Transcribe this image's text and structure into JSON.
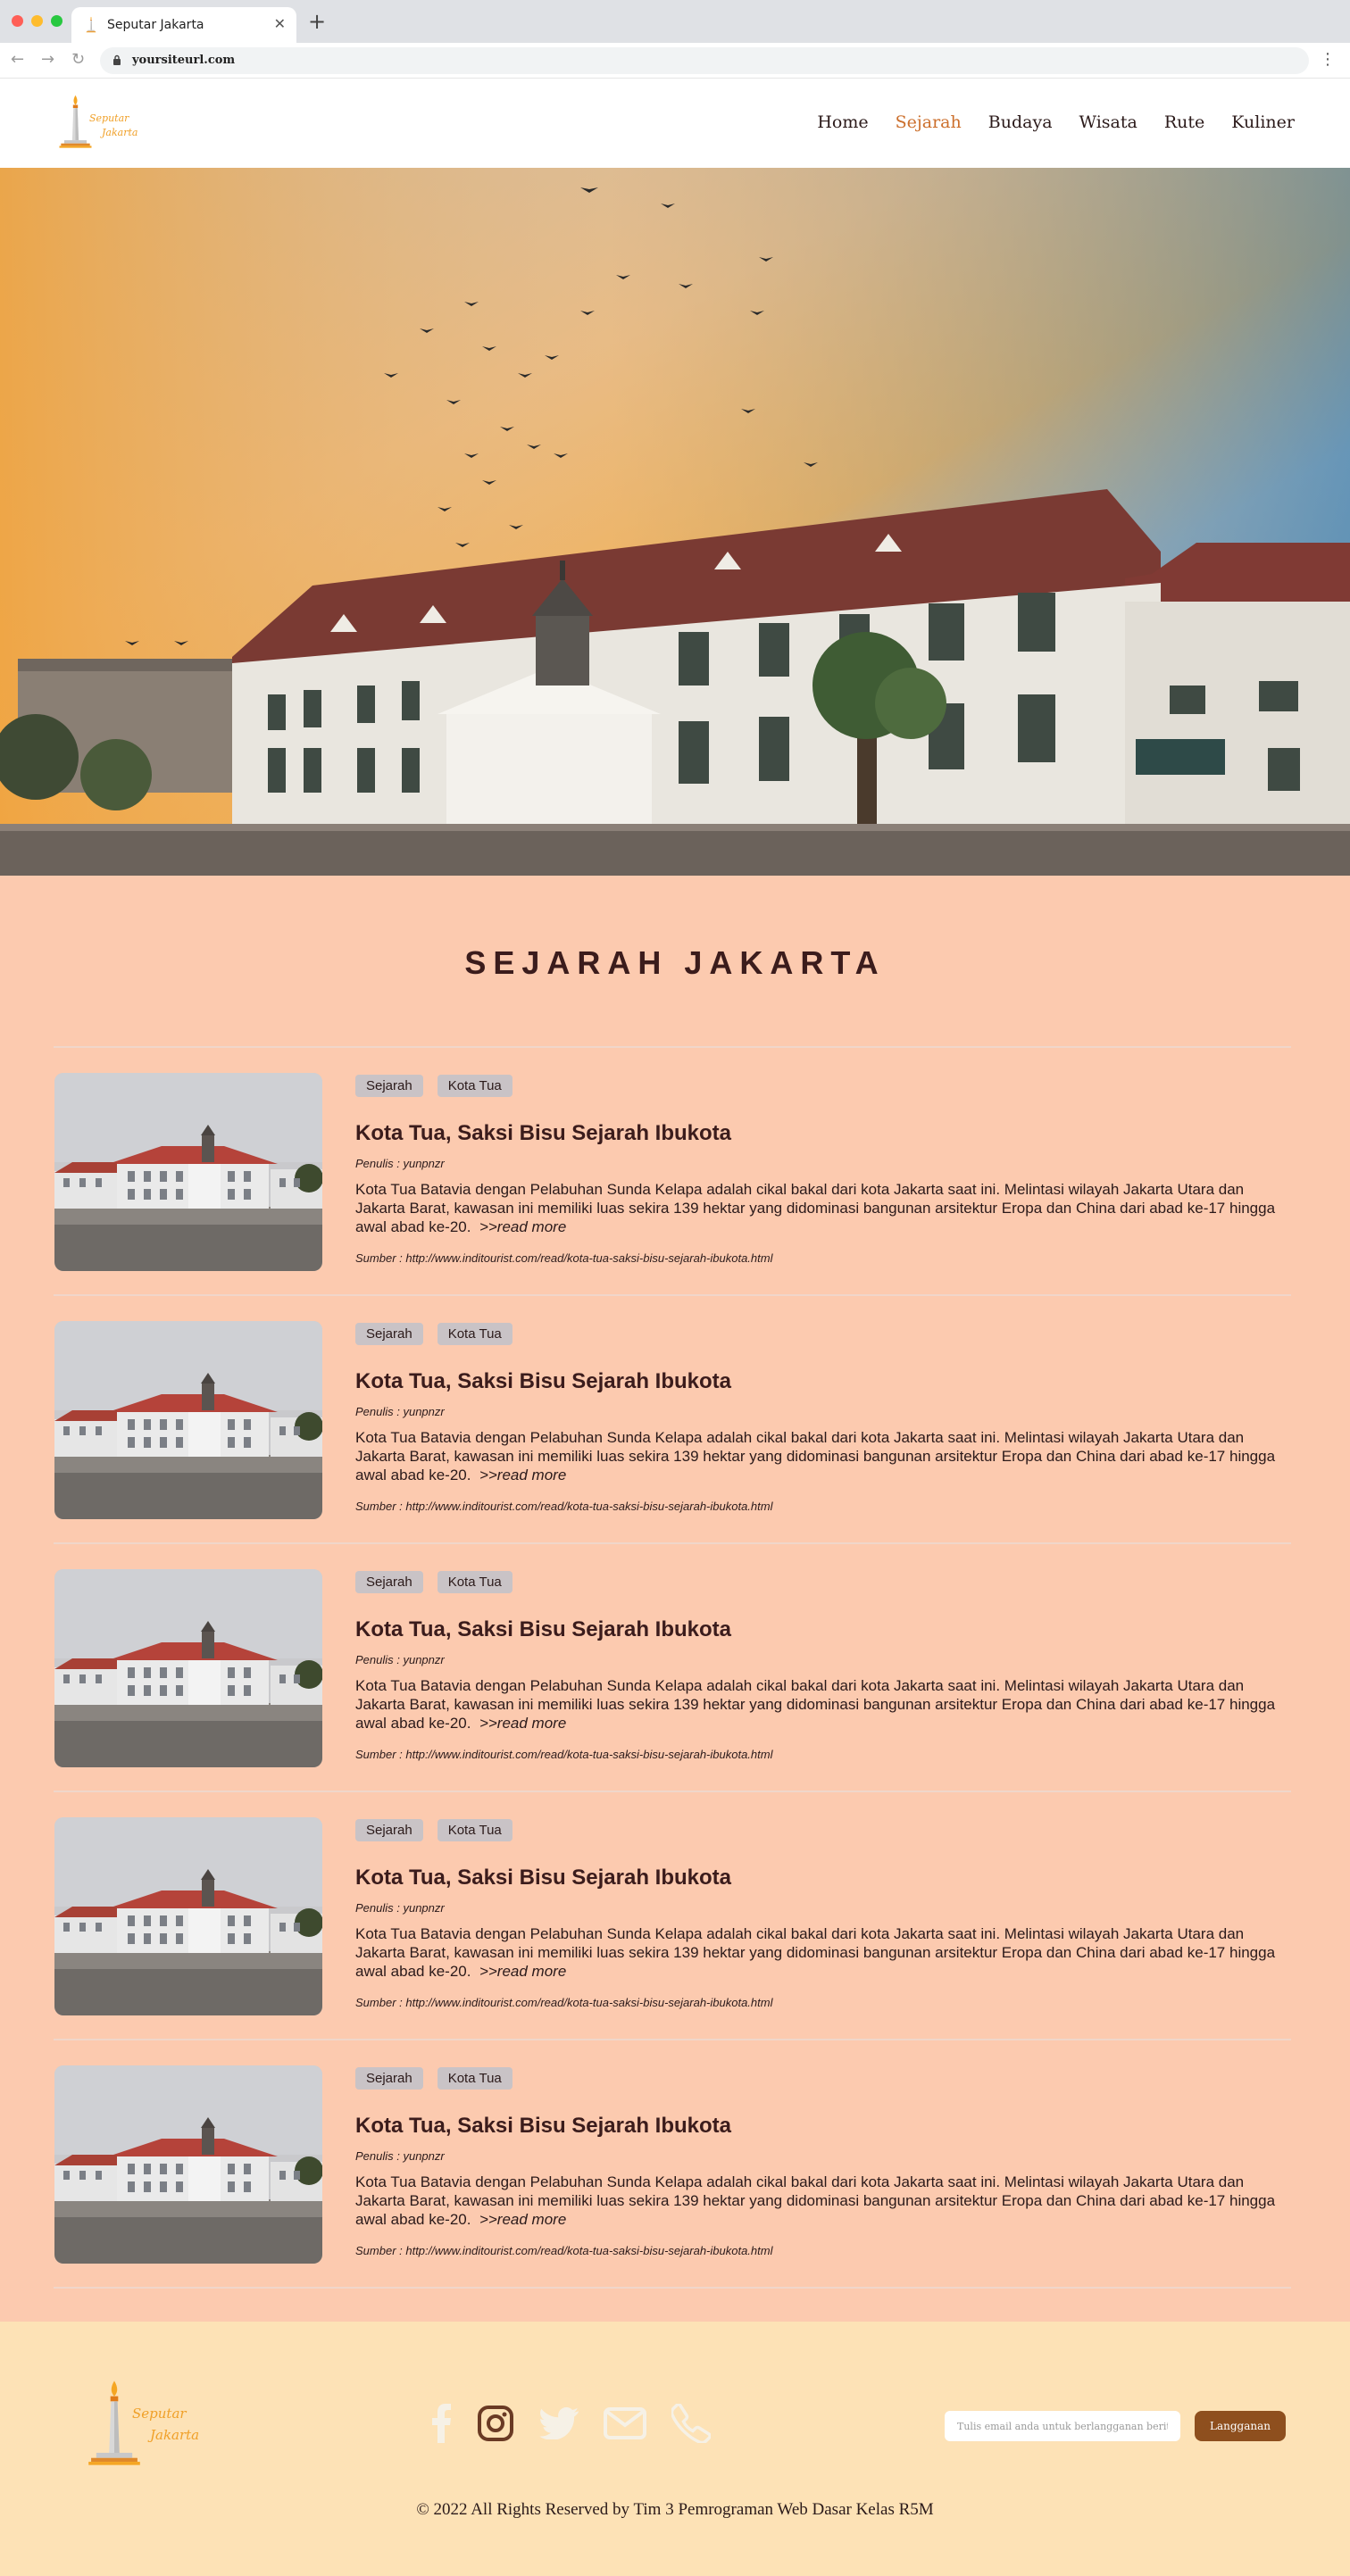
{
  "browser": {
    "tab_title": "Seputar Jakarta",
    "tab_close": "✕",
    "new_tab": "+",
    "url": "yoursiteurl.com",
    "back": "←",
    "forward": "→",
    "reload": "↻",
    "menu": "⋮"
  },
  "brand": {
    "logo_line1": "Seputar",
    "logo_line2": "Jakarta",
    "accent": "#cc6f2c"
  },
  "nav": {
    "items": [
      {
        "label": "Home",
        "active": false
      },
      {
        "label": "Sejarah",
        "active": true
      },
      {
        "label": "Budaya",
        "active": false
      },
      {
        "label": "Wisata",
        "active": false
      },
      {
        "label": "Rute",
        "active": false
      },
      {
        "label": "Kuliner",
        "active": false
      }
    ]
  },
  "hero": {
    "image": "Kota Tua Jakarta museum building at sunset with flock of birds"
  },
  "main": {
    "title": "SEJARAH JAKARTA",
    "articles": [
      {
        "tags": [
          "Sejarah",
          "Kota Tua"
        ],
        "title": "Kota Tua, Saksi Bisu Sejarah Ibukota",
        "author": "Penulis : yunpnzr",
        "excerpt": "Kota Tua Batavia dengan Pelabuhan Sunda Kelapa adalah cikal bakal dari kota Jakarta saat ini. Melintasi wilayah Jakarta Utara dan Jakarta Barat, kawasan ini memiliki luas sekira 139 hektar yang didominasi bangunan arsitektur Eropa dan China dari abad ke-17 hingga awal abad ke-20.",
        "read_more": ">>read more",
        "source": "Sumber : http://www.inditourist.com/read/kota-tua-saksi-bisu-sejarah-ibukota.html"
      },
      {
        "tags": [
          "Sejarah",
          "Kota Tua"
        ],
        "title": "Kota Tua, Saksi Bisu Sejarah Ibukota",
        "author": "Penulis : yunpnzr",
        "excerpt": "Kota Tua Batavia dengan Pelabuhan Sunda Kelapa adalah cikal bakal dari kota Jakarta saat ini. Melintasi wilayah Jakarta Utara dan Jakarta Barat, kawasan ini memiliki luas sekira 139 hektar yang didominasi bangunan arsitektur Eropa dan China dari abad ke-17 hingga awal abad ke-20.",
        "read_more": ">>read more",
        "source": "Sumber : http://www.inditourist.com/read/kota-tua-saksi-bisu-sejarah-ibukota.html"
      },
      {
        "tags": [
          "Sejarah",
          "Kota Tua"
        ],
        "title": "Kota Tua, Saksi Bisu Sejarah Ibukota",
        "author": "Penulis : yunpnzr",
        "excerpt": "Kota Tua Batavia dengan Pelabuhan Sunda Kelapa adalah cikal bakal dari kota Jakarta saat ini. Melintasi wilayah Jakarta Utara dan Jakarta Barat, kawasan ini memiliki luas sekira 139 hektar yang didominasi bangunan arsitektur Eropa dan China dari abad ke-17 hingga awal abad ke-20.",
        "read_more": ">>read more",
        "source": "Sumber : http://www.inditourist.com/read/kota-tua-saksi-bisu-sejarah-ibukota.html"
      },
      {
        "tags": [
          "Sejarah",
          "Kota Tua"
        ],
        "title": "Kota Tua, Saksi Bisu Sejarah Ibukota",
        "author": "Penulis : yunpnzr",
        "excerpt": "Kota Tua Batavia dengan Pelabuhan Sunda Kelapa adalah cikal bakal dari kota Jakarta saat ini. Melintasi wilayah Jakarta Utara dan Jakarta Barat, kawasan ini memiliki luas sekira 139 hektar yang didominasi bangunan arsitektur Eropa dan China dari abad ke-17 hingga awal abad ke-20.",
        "read_more": ">>read more",
        "source": "Sumber : http://www.inditourist.com/read/kota-tua-saksi-bisu-sejarah-ibukota.html"
      },
      {
        "tags": [
          "Sejarah",
          "Kota Tua"
        ],
        "title": "Kota Tua, Saksi Bisu Sejarah Ibukota",
        "author": "Penulis : yunpnzr",
        "excerpt": "Kota Tua Batavia dengan Pelabuhan Sunda Kelapa adalah cikal bakal dari kota Jakarta saat ini. Melintasi wilayah Jakarta Utara dan Jakarta Barat, kawasan ini memiliki luas sekira 139 hektar yang didominasi bangunan arsitektur Eropa dan China dari abad ke-17 hingga awal abad ke-20.",
        "read_more": ">>read more",
        "source": "Sumber : http://www.inditourist.com/read/kota-tua-saksi-bisu-sejarah-ibukota.html"
      }
    ]
  },
  "footer": {
    "socials": [
      "facebook-icon",
      "instagram-icon",
      "twitter-icon",
      "mail-icon",
      "phone-icon"
    ],
    "email_placeholder": "Tulis email anda untuk berlangganan berita",
    "subscribe_label": "Langganan",
    "copyright": "© 2022 All Rights Reserved by Tim 3 Pemrograman Web Dasar Kelas R5M",
    "background": "#fde2b6",
    "button_color": "#8e4f1e"
  }
}
